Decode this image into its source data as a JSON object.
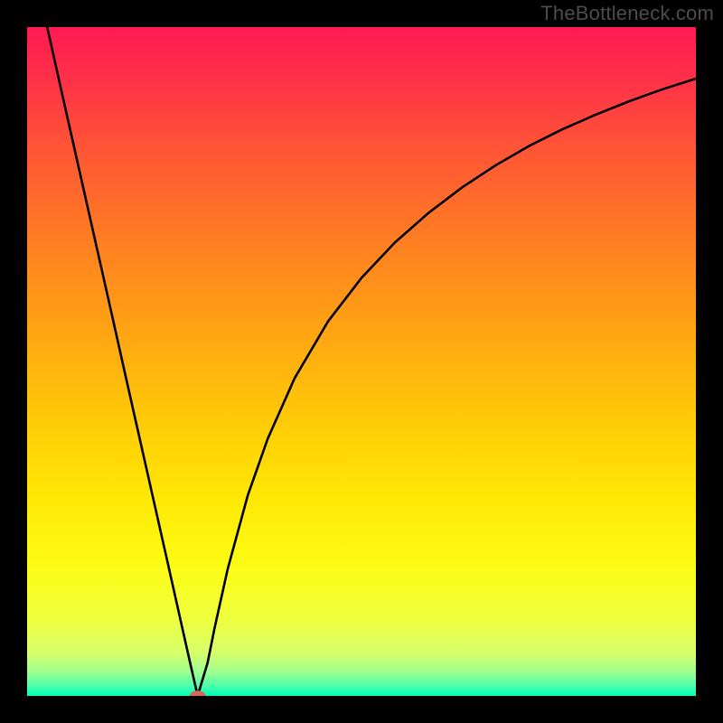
{
  "watermark": "TheBottleneck.com",
  "chart_data": {
    "type": "line",
    "title": "",
    "xlabel": "",
    "ylabel": "",
    "xlim": [
      0,
      100
    ],
    "ylim": [
      0,
      100
    ],
    "gradient_stops": [
      {
        "offset": 0.0,
        "color": "#ff1a52"
      },
      {
        "offset": 0.07,
        "color": "#ff2e49"
      },
      {
        "offset": 0.18,
        "color": "#ff5436"
      },
      {
        "offset": 0.32,
        "color": "#ff7e22"
      },
      {
        "offset": 0.45,
        "color": "#ffa313"
      },
      {
        "offset": 0.58,
        "color": "#ffc808"
      },
      {
        "offset": 0.7,
        "color": "#ffe704"
      },
      {
        "offset": 0.8,
        "color": "#fdfb12"
      },
      {
        "offset": 0.88,
        "color": "#f0ff3a"
      },
      {
        "offset": 0.935,
        "color": "#d8ff6a"
      },
      {
        "offset": 0.965,
        "color": "#9cff90"
      },
      {
        "offset": 0.985,
        "color": "#4bffab"
      },
      {
        "offset": 1.0,
        "color": "#00ffb8"
      }
    ],
    "series": [
      {
        "name": "bottleneck-curve",
        "x": [
          3.0,
          6,
          9,
          12,
          15,
          18,
          21,
          24,
          25.5,
          27,
          28,
          30,
          33,
          36,
          40,
          45,
          50,
          55,
          60,
          65,
          70,
          75,
          80,
          85,
          90,
          95,
          100
        ],
        "y": [
          100,
          86.6,
          73.3,
          60.0,
          46.6,
          33.3,
          20.0,
          6.6,
          0.0,
          5.0,
          10.0,
          19.0,
          30.0,
          38.5,
          47.5,
          56.0,
          62.5,
          67.8,
          72.2,
          76.0,
          79.3,
          82.2,
          84.7,
          86.9,
          88.9,
          90.7,
          92.3
        ]
      }
    ],
    "marker": {
      "x": 25.5,
      "y": 0.0,
      "rx": 1.2,
      "ry": 0.8,
      "color": "#d46a5a"
    }
  }
}
